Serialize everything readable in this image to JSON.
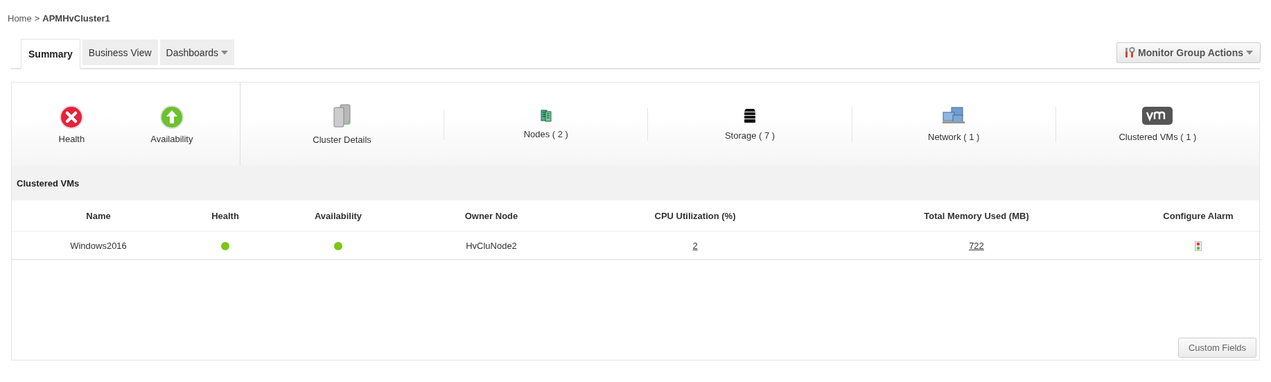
{
  "breadcrumb": {
    "home": "Home",
    "separator": ">",
    "current": "APMHvCluster1"
  },
  "tabs": [
    {
      "label": "Summary",
      "selected": true,
      "dropdown": false
    },
    {
      "label": "Business View",
      "selected": false,
      "dropdown": false
    },
    {
      "label": "Dashboards",
      "selected": false,
      "dropdown": true
    }
  ],
  "actions_button": "Monitor Group Actions",
  "status": [
    {
      "label": "Health",
      "kind": "critical"
    },
    {
      "label": "Availability",
      "kind": "up"
    }
  ],
  "summary_items": [
    {
      "kind": "cluster",
      "label": "Cluster Details"
    },
    {
      "kind": "nodes",
      "label": "Nodes ( 2 )"
    },
    {
      "kind": "storage",
      "label": "Storage ( 7 )"
    },
    {
      "kind": "network",
      "label": "Network ( 1 )"
    },
    {
      "kind": "vm",
      "label": "Clustered VMs ( 1 )"
    }
  ],
  "section_title": "Clustered VMs",
  "table": {
    "columns": [
      "Name",
      "Health",
      "Availability",
      "Owner Node",
      "CPU Utilization (%)",
      "Total Memory Used (MB)",
      "Configure Alarm"
    ],
    "rows": [
      {
        "name": "Windows2016",
        "health": {
          "color": "#7cc614"
        },
        "availability": {
          "color": "#7cc614"
        },
        "owner_node": "HvCluNode2",
        "cpu": "2",
        "memory": "722"
      }
    ]
  },
  "custom_fields_button": "Custom Fields"
}
